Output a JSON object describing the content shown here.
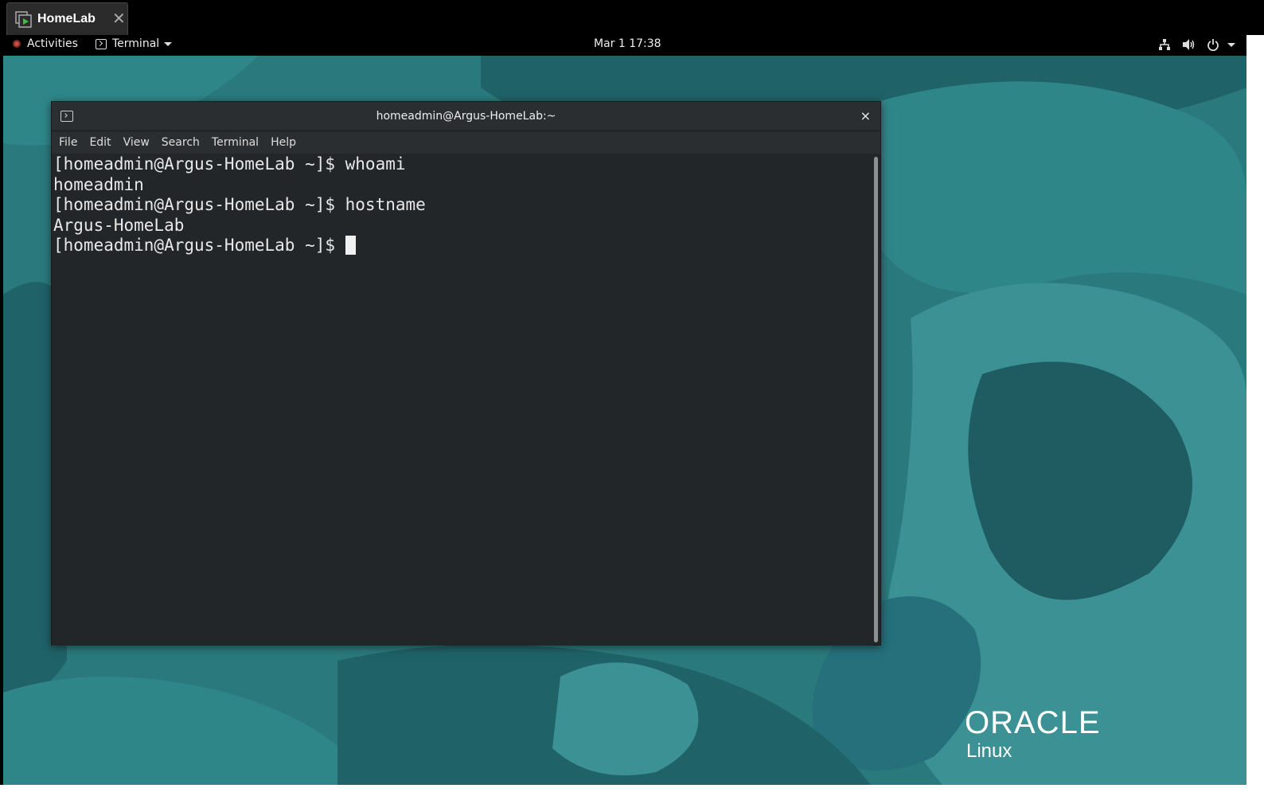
{
  "host": {
    "tab_label": "HomeLab",
    "tab_close": "✕"
  },
  "topbar": {
    "activities": "Activities",
    "app_menu": "Terminal",
    "clock": "Mar 1  17:38"
  },
  "terminal": {
    "title": "homeadmin@Argus-HomeLab:~",
    "close": "×",
    "menu": [
      "File",
      "Edit",
      "View",
      "Search",
      "Terminal",
      "Help"
    ],
    "lines": [
      "[homeadmin@Argus-HomeLab ~]$ whoami",
      "homeadmin",
      "[homeadmin@Argus-HomeLab ~]$ hostname",
      "Argus-HomeLab",
      "[homeadmin@Argus-HomeLab ~]$ "
    ]
  },
  "desktop": {
    "logo_word": "ORACLE",
    "logo_sub": "Linux",
    "colors": {
      "base": "#2a7a7d",
      "dark": "#1f5e63",
      "light": "#3f9497"
    }
  }
}
